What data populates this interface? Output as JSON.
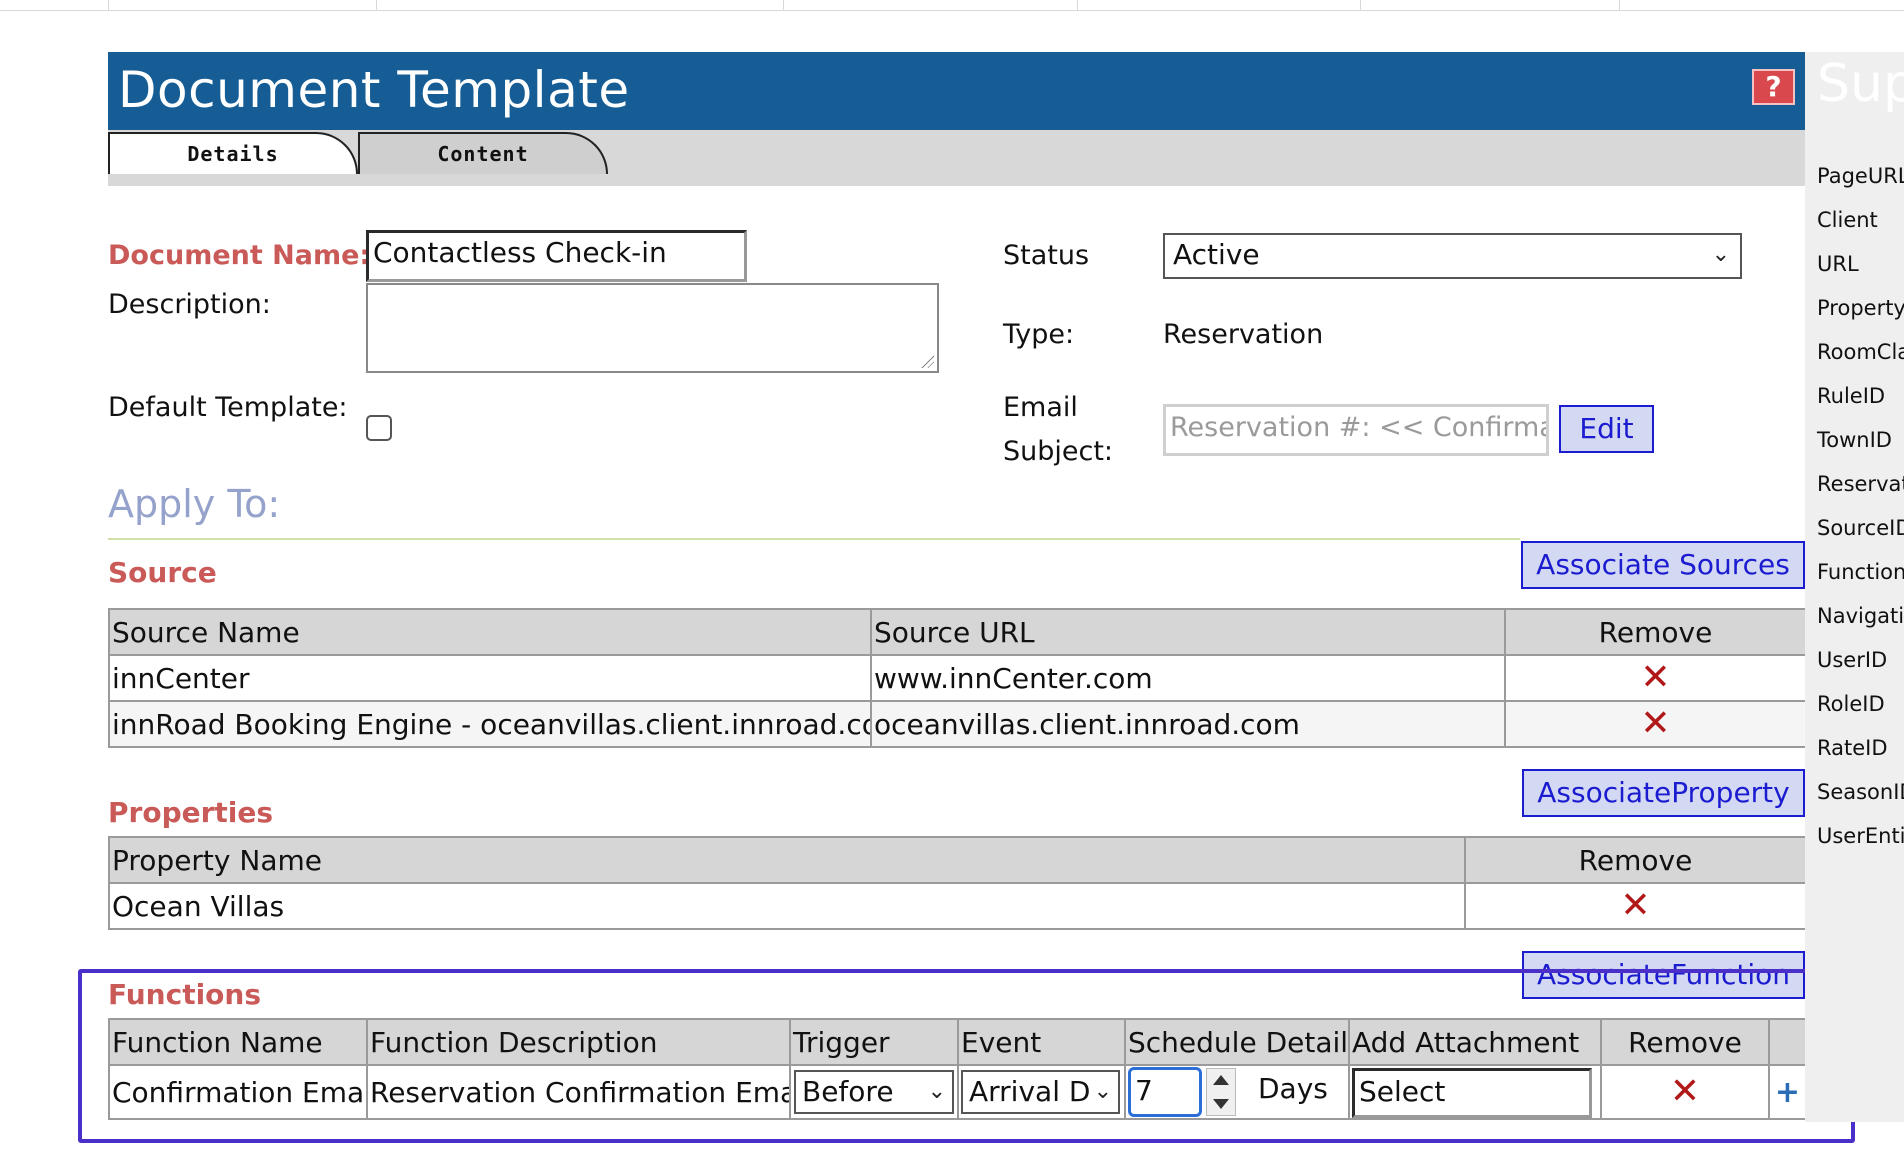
{
  "header": {
    "title": "Document Template",
    "help_glyph": "?"
  },
  "tabs": [
    {
      "label": "Details"
    },
    {
      "label": "Content"
    }
  ],
  "form": {
    "document_name_label": "Document Name:",
    "document_name_value": "Contactless Check-in",
    "description_label": "Description:",
    "description_value": "",
    "default_template_label": "Default Template:",
    "status_label": "Status",
    "status_value": "Active",
    "type_label": "Type:",
    "type_value": "Reservation",
    "email_subject_label_line1": "Email",
    "email_subject_label_line2": "Subject:",
    "email_subject_value": "Reservation #: << Confirma",
    "edit_button": "Edit"
  },
  "apply_to": {
    "heading": "Apply To:"
  },
  "source": {
    "heading": "Source",
    "associate_button": "Associate Sources",
    "columns": [
      "Source Name",
      "Source URL",
      "Remove"
    ],
    "rows": [
      {
        "name": "innCenter",
        "url": "www.innCenter.com"
      },
      {
        "name": "innRoad Booking Engine - oceanvillas.client.innroad.com",
        "url": "oceanvillas.client.innroad.com"
      }
    ]
  },
  "properties": {
    "heading": "Properties",
    "associate_button": "AssociateProperty",
    "columns": [
      "Property Name",
      "Remove"
    ],
    "rows": [
      {
        "name": "Ocean Villas"
      }
    ]
  },
  "functions": {
    "heading": "Functions",
    "associate_button": "AssociateFunction",
    "columns": [
      "Function Name",
      "Function Description",
      "Trigger",
      "Event",
      "Schedule Details",
      "Add Attachment",
      "Remove"
    ],
    "rows": [
      {
        "name": "Confirmation Email",
        "description": "Reservation Confirmation Email",
        "trigger": "Before",
        "event": "Arrival D",
        "schedule_value": "7",
        "schedule_unit": "Days",
        "attachment": "Select"
      }
    ]
  },
  "sidebar": {
    "title": "Sup",
    "items": [
      "PageURL",
      "Client",
      "URL",
      "PropertyI",
      "RoomCla",
      "RuleID",
      "TownID",
      "Reservati",
      "SourceID",
      "FunctionI",
      "Navigatio",
      "UserID",
      "RoleID",
      "RateID",
      "SeasonID",
      "UserEntit"
    ]
  },
  "icons": {
    "remove": "close-x-icon",
    "add": "plus-icon",
    "dropdown": "chevron-down-icon",
    "help": "question-icon"
  },
  "colors": {
    "header_bg": "#155d94",
    "required_label": "#c95a58",
    "link_blue": "#1b1bd0",
    "remove_red": "#b11818",
    "highlight": "#4a2fc9"
  }
}
